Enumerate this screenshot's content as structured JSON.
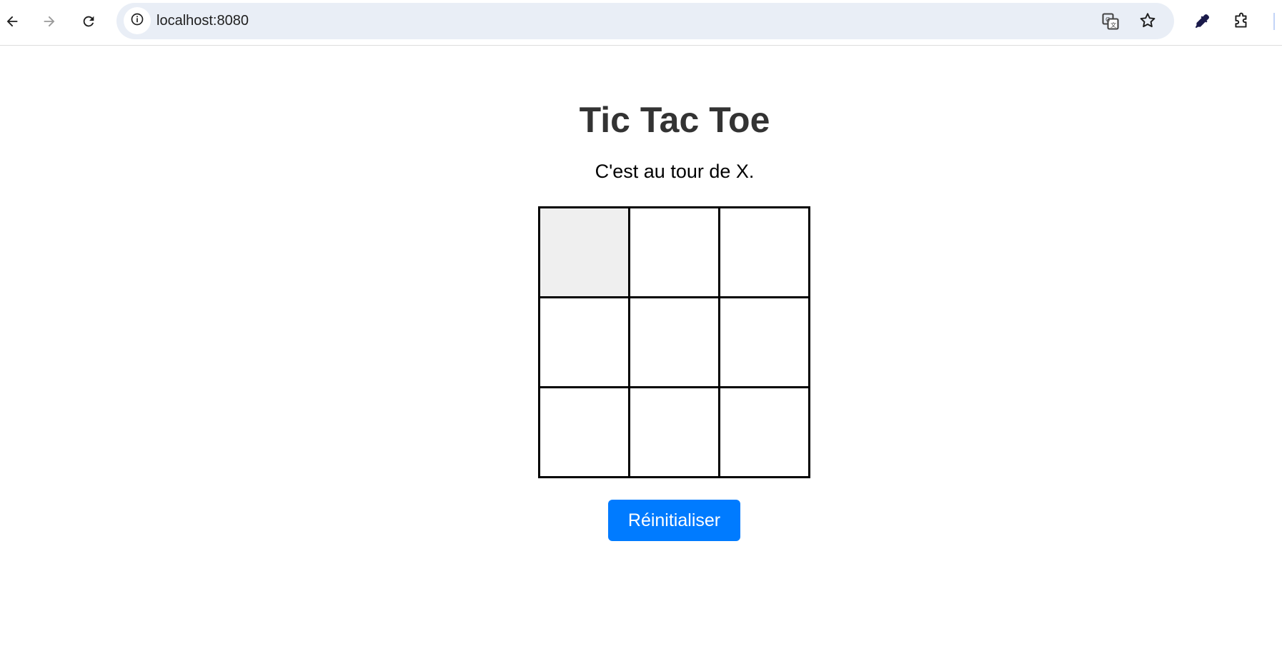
{
  "browser": {
    "url": "localhost:8080",
    "icons": {
      "back": "arrow-left-icon",
      "forward": "arrow-right-icon",
      "reload": "reload-icon",
      "site_info": "info-icon",
      "translate": "translate-icon",
      "bookmark": "star-icon",
      "eyedropper": "eyedropper-icon",
      "extensions": "puzzle-icon"
    }
  },
  "game": {
    "title": "Tic Tac Toe",
    "status": "C'est au tour de X.",
    "board": [
      "",
      "",
      "",
      "",
      "",
      "",
      "",
      "",
      ""
    ],
    "hovered_cell": 0,
    "reset_label": "Réinitialiser"
  },
  "colors": {
    "button": "#007bff",
    "title": "#333333",
    "hover_cell": "#efefef",
    "omnibox": "#e9eef6"
  }
}
